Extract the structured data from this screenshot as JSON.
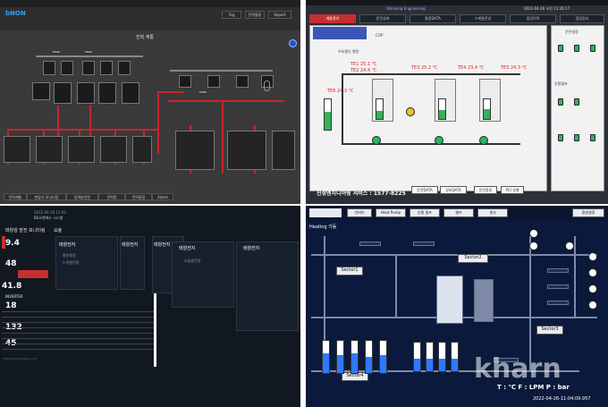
{
  "q1": {
    "brand": "bNON",
    "title": "전력 계통",
    "buttons": [
      "Tag",
      "전력통합",
      "Report"
    ],
    "bottom_tabs": [
      "전력계통",
      "변압기 모니터링",
      "동력분전반",
      "전력량",
      "전력통합",
      "Alarm"
    ],
    "panels": [
      "MAIN",
      "MAIN",
      "MAIN"
    ]
  },
  "q2": {
    "tabs": [
      "계통관리",
      "운전상태",
      "통합DATA",
      "스케줄운영",
      "점검이력",
      "점검일지"
    ],
    "header_title": "Shinsung Engineering",
    "datetime": "2022-04-26 오전 11:26:17",
    "temps": [
      "TE1 25.1 ℃",
      "TE2 24.4 ℃",
      "TE3 25.2 ℃",
      "TE4 23.4 ℃",
      "TE5 24.3 ℃",
      "TE6 24.3 ℃"
    ],
    "labels": [
      "COP",
      "수요중인 열량",
      "순환펌프"
    ],
    "service": "신성엔지니어링 서비스 : 1577-8225",
    "buttons": [
      "운전DATA",
      "경보DATA",
      "운전종료",
      "PCI 실행"
    ],
    "chart_title": "운전설정"
  },
  "q3": {
    "title": "태양광 발전 모니터링",
    "sub": "요율",
    "site": "BS오엔에스 시스템",
    "date": "2022-04-26 11:02",
    "side_values": [
      "9.4",
      "48",
      "41.8",
      "18",
      "132",
      "45"
    ],
    "section": "INVERTER",
    "panels": [
      "태양전지",
      "태양전지",
      "태양전지",
      "태양전지",
      "태양전지"
    ],
    "labels": [
      "발전용량",
      "누적발전량",
      "오늘발전량"
    ],
    "footer": "Monitoring Program v1.0"
  },
  "q4": {
    "tabs": [
      "인버터",
      "Heat Pump",
      "순환 펌프",
      "밸브",
      "센서",
      "환경설정"
    ],
    "mode": "Heating 가동",
    "sectors": [
      "Sector1",
      "Sector2",
      "Sector3",
      "Sector4"
    ],
    "watermark": "kharn",
    "footer_units": "T : ℃  F : LPM  P : bar",
    "datetime": "2022-04-26-11:04:09.957"
  },
  "colors": {
    "alarm_red": "#c8262b",
    "pump_green": "#2fb35b",
    "heat_blue": "#0b1a3c"
  }
}
